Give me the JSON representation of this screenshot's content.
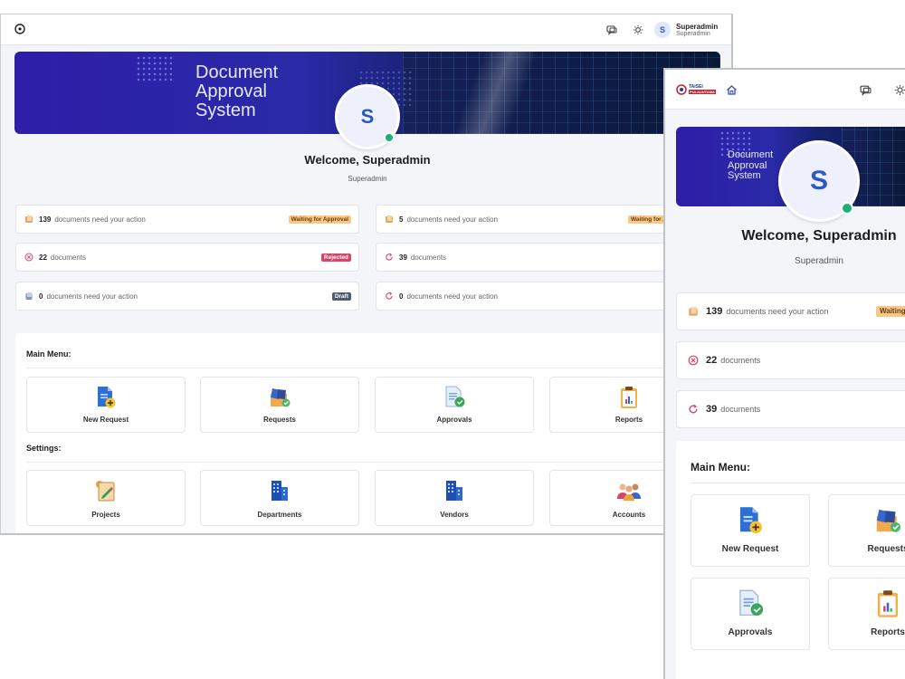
{
  "desktop": {
    "user": {
      "initial": "S",
      "name": "Superadmin",
      "role": "Superadmin"
    },
    "banner": {
      "line1": "Document",
      "line2": "Approval",
      "line3": "System"
    },
    "welcome": "Welcome, Superadmin",
    "role": "Superadmin",
    "stats": [
      {
        "num": "139",
        "text": "documents need your action",
        "badge": "Waiting for Approval"
      },
      {
        "num": "5",
        "text": "documents need your action",
        "badge": "Waiting for A"
      },
      {
        "num": "22",
        "text": "documents",
        "badge": "Rejected"
      },
      {
        "num": "39",
        "text": "documents",
        "badge": ""
      },
      {
        "num": "0",
        "text": "documents need your action",
        "badge": "Draft"
      },
      {
        "num": "0",
        "text": "documents need your action",
        "badge": ""
      }
    ],
    "main_menu_title": "Main Menu:",
    "main_menu": [
      "New Request",
      "Requests",
      "Approvals",
      "Reports"
    ],
    "settings_title": "Settings:",
    "settings": [
      "Projects",
      "Departments",
      "Vendors",
      "Accounts"
    ]
  },
  "mobile": {
    "logo": {
      "line1": "TAISEI",
      "line2": "PULAUUTAMA"
    },
    "banner": {
      "line1": "Document",
      "line2": "Approval",
      "line3": "System"
    },
    "avatar_initial": "S",
    "welcome": "Welcome, Superadmin",
    "role": "Superadmin",
    "stats": [
      {
        "num": "139",
        "text": "documents need your action",
        "badge": "Waiting"
      },
      {
        "num": "22",
        "text": "documents"
      },
      {
        "num": "39",
        "text": "documents"
      }
    ],
    "main_menu_title": "Main Menu:",
    "main_menu": [
      "New Request",
      "Requests",
      "Approvals",
      "Reports"
    ]
  },
  "colors": {
    "badge_waiting": "#f6c88a",
    "badge_rejected": "#d9436a",
    "badge_draft": "#4e5b70",
    "accent_blue": "#2f55c9",
    "online": "#1fb07a"
  }
}
